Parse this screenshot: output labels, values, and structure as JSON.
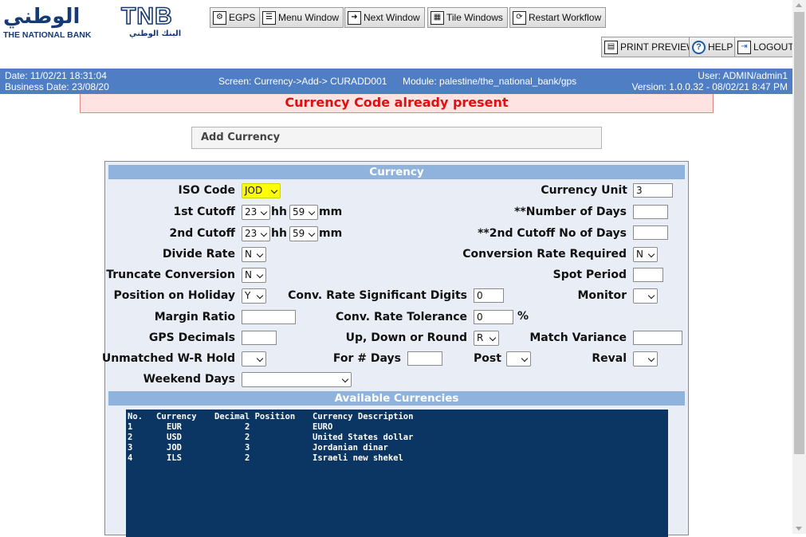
{
  "logo": {
    "arabic": "الوطني",
    "tnb": "TNB",
    "english": "THE NATIONAL BANK",
    "arabic_small": "البنك الوطني"
  },
  "toolbar": {
    "egps": "EGPS",
    "menu_window": "Menu Window",
    "next_window": "Next Window",
    "tile_windows": "Tile Windows",
    "restart_workflow": "Restart Workflow",
    "print_preview": "PRINT PREVIEW",
    "help": "HELP",
    "logout": "LOGOUT"
  },
  "infobar": {
    "date": "Date: 11/02/21 18:31:04",
    "business_date": "Business Date: 23/08/20",
    "screen": "Screen: Currency->Add-> CURADD001",
    "module": "Module: palestine/the_national_bank/gps",
    "user": "User: ADMIN/admin1",
    "version": "Version: 1.0.0.32 - 08/02/21 8:47 PM"
  },
  "error_message": "Currency Code already present",
  "section_title": "Add Currency",
  "currency_header": "Currency",
  "form": {
    "iso_code_label": "ISO Code",
    "iso_code_value": "JOD",
    "currency_unit_label": "Currency Unit",
    "currency_unit_value": "3",
    "cutoff1_label": "1st Cutoff",
    "cutoff1_hh": "23",
    "cutoff1_mm": "59",
    "hh_label": "hh",
    "mm_label": "mm",
    "number_of_days_label": "**Number of Days",
    "number_of_days_value": "",
    "cutoff2_label": "2nd Cutoff",
    "cutoff2_hh": "23",
    "cutoff2_mm": "59",
    "cutoff2_no_days_label": "**2nd Cutoff No of Days",
    "cutoff2_no_days_value": "",
    "divide_rate_label": "Divide Rate",
    "divide_rate_value": "N",
    "conversion_rate_required_label": "Conversion Rate Required",
    "conversion_rate_required_value": "N",
    "truncate_conversion_label": "Truncate Conversion",
    "truncate_conversion_value": "N",
    "spot_period_label": "Spot Period",
    "spot_period_value": "",
    "position_on_holiday_label": "Position on Holiday",
    "position_on_holiday_value": "Y",
    "conv_rate_sig_digits_label": "Conv. Rate Significant Digits",
    "conv_rate_sig_digits_value": "0",
    "monitor_label": "Monitor",
    "monitor_value": "",
    "margin_ratio_label": "Margin Ratio",
    "margin_ratio_value": "",
    "conv_rate_tolerance_label": "Conv. Rate Tolerance",
    "conv_rate_tolerance_value": "0",
    "percent_sign": "%",
    "gps_decimals_label": "GPS Decimals",
    "gps_decimals_value": "",
    "up_down_round_label": "Up, Down or Round",
    "up_down_round_value": "R",
    "match_variance_label": "Match Variance",
    "match_variance_value": "",
    "unmatched_wr_hold_label": "Unmatched W-R Hold",
    "unmatched_wr_hold_value": "",
    "for_days_label": "For # Days",
    "for_days_value": "",
    "post_label": "Post",
    "post_value": "",
    "reval_label": "Reval",
    "reval_value": "",
    "weekend_days_label": "Weekend Days",
    "weekend_days_value": ""
  },
  "available_header": "Available Currencies",
  "currency_list": {
    "columns": [
      "No.",
      "Currency",
      "Decimal Position",
      "Currency Description"
    ],
    "rows": [
      [
        "1",
        "EUR",
        "2",
        "EURO"
      ],
      [
        "2",
        "USD",
        "2",
        "United States dollar"
      ],
      [
        "3",
        "JOD",
        "3",
        "Jordanian dinar"
      ],
      [
        "4",
        "ILS",
        "2",
        "Israeli new shekel"
      ]
    ]
  }
}
